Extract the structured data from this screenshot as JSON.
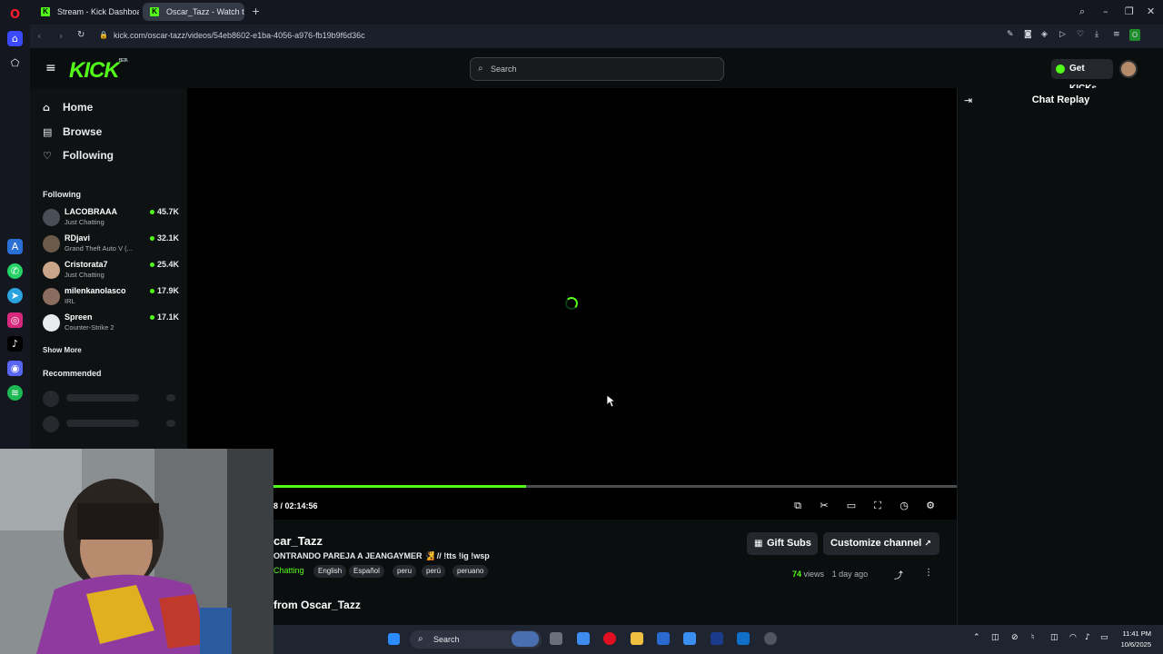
{
  "browser": {
    "tabs": [
      {
        "label": "Stream - Kick Dashboard"
      },
      {
        "label": "Oscar_Tazz - Watch the V"
      }
    ],
    "url": "kick.com/oscar-tazz/videos/54eb8602-e1ba-4056-a976-fb19b9f6d36c"
  },
  "header": {
    "logo": "KICK",
    "logo_badge": "BETA",
    "search_placeholder": "Search",
    "get_kicks_label": "Get KICKs"
  },
  "sidebar": {
    "nav": [
      {
        "label": "Home",
        "icon": "home-icon"
      },
      {
        "label": "Browse",
        "icon": "browse-icon"
      },
      {
        "label": "Following",
        "icon": "heart-icon"
      }
    ],
    "following_title": "Following",
    "following": [
      {
        "name": "LACOBRAAA",
        "category": "Just Chatting",
        "viewers": "45.7K"
      },
      {
        "name": "RDjavi",
        "category": "Grand Theft Auto V (...",
        "viewers": "32.1K"
      },
      {
        "name": "Cristorata7",
        "category": "Just Chatting",
        "viewers": "25.4K"
      },
      {
        "name": "milenkanolasco",
        "category": "IRL",
        "viewers": "17.9K"
      },
      {
        "name": "Spreen",
        "category": "Counter-Strike 2",
        "viewers": "17.1K"
      }
    ],
    "show_more": "Show More",
    "recommended_title": "Recommended"
  },
  "player": {
    "time": "8 / 02:14:56",
    "progress": 0.37
  },
  "chat": {
    "title": "Chat Replay"
  },
  "video_info": {
    "channel_name": "car_Tazz",
    "title": "ONTRANDO PAREJA A JEANGAYMER 🧏 // !tts !ig !wsp",
    "category": "Chatting",
    "tags": [
      "English",
      "Español",
      "peru",
      "perú",
      "peruano"
    ],
    "gift_subs_label": "Gift Subs",
    "customize_label": "Customize channel",
    "views_count": "74",
    "views_label": "views",
    "age": "1 day ago",
    "from_label": "from Oscar_Tazz"
  },
  "taskbar": {
    "search_label": "Search",
    "time": "11:41 PM",
    "date": "10/6/2025"
  },
  "colors": {
    "accent": "#53fc18",
    "background": "#0b0e0f"
  }
}
